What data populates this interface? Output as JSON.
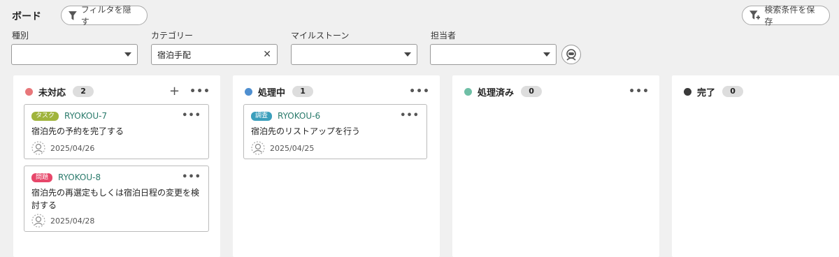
{
  "header": {
    "title": "ボード",
    "hide_filter_label": "フィルタを隠す",
    "save_search_label": "検索条件を保存"
  },
  "filters": {
    "type": {
      "label": "種別",
      "value": ""
    },
    "category": {
      "label": "カテゴリー",
      "value": "宿泊手配"
    },
    "milestone": {
      "label": "マイルストーン",
      "value": ""
    },
    "assignee": {
      "label": "担当者",
      "value": ""
    }
  },
  "columns": [
    {
      "name": "未対応",
      "count": "2",
      "color": "#e8777a",
      "cards": [
        {
          "badge": "タスク",
          "badge_color": "#a0b43c",
          "key": "RYOKOU-7",
          "title": "宿泊先の予約を完了する",
          "date": "2025/04/26"
        },
        {
          "badge": "問題",
          "badge_color": "#e7476a",
          "key": "RYOKOU-8",
          "title": "宿泊先の再選定もしくは宿泊日程の変更を検討する",
          "date": "2025/04/28"
        }
      ]
    },
    {
      "name": "処理中",
      "count": "1",
      "color": "#4f8fd0",
      "cards": [
        {
          "badge": "調査",
          "badge_color": "#3b9fbc",
          "key": "RYOKOU-6",
          "title": "宿泊先のリストアップを行う",
          "date": "2025/04/25"
        }
      ]
    },
    {
      "name": "処理済み",
      "count": "0",
      "color": "#6fbfa6",
      "cards": []
    },
    {
      "name": "完了",
      "count": "0",
      "color": "#3a3a3a",
      "cards": []
    }
  ]
}
